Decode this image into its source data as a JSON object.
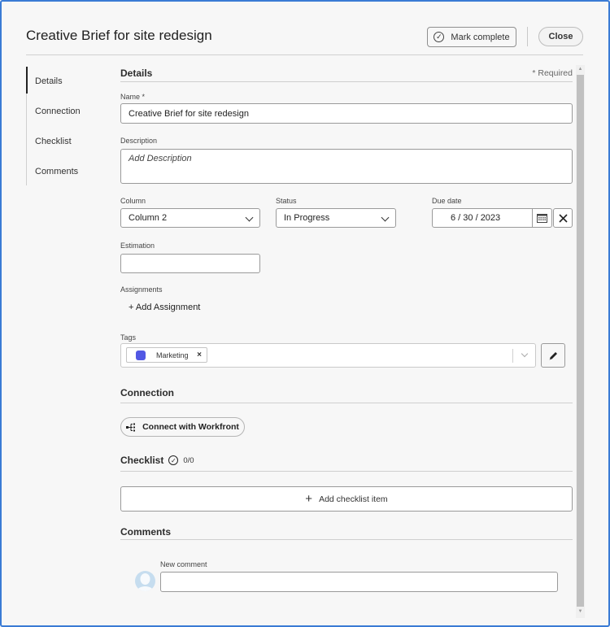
{
  "header": {
    "title": "Creative Brief for site redesign",
    "mark_complete_label": "Mark complete",
    "close_label": "Close"
  },
  "nav": {
    "items": [
      {
        "label": "Details",
        "active": true
      },
      {
        "label": "Connection",
        "active": false
      },
      {
        "label": "Checklist",
        "active": false
      },
      {
        "label": "Comments",
        "active": false
      }
    ]
  },
  "details": {
    "section_title": "Details",
    "required_note": "* Required",
    "name": {
      "label": "Name *",
      "value": "Creative Brief for site redesign"
    },
    "description": {
      "label": "Description",
      "placeholder": "Add Description",
      "value": ""
    },
    "column": {
      "label": "Column",
      "value": "Column 2"
    },
    "status": {
      "label": "Status",
      "value": "In Progress"
    },
    "due_date": {
      "label": "Due date",
      "value": "6 / 30 / 2023"
    },
    "estimation": {
      "label": "Estimation",
      "value": ""
    },
    "assignments": {
      "label": "Assignments",
      "add_label": "+ Add Assignment"
    },
    "tags": {
      "label": "Tags",
      "items": [
        {
          "label": "Marketing",
          "color": "#5258e4"
        }
      ],
      "remove_glyph": "×"
    }
  },
  "connection": {
    "section_title": "Connection",
    "button_label": "Connect with Workfront"
  },
  "checklist": {
    "section_title": "Checklist",
    "count": "0/0",
    "add_label": "Add checklist item"
  },
  "comments": {
    "section_title": "Comments",
    "new_comment_label": "New comment",
    "new_comment_value": ""
  }
}
